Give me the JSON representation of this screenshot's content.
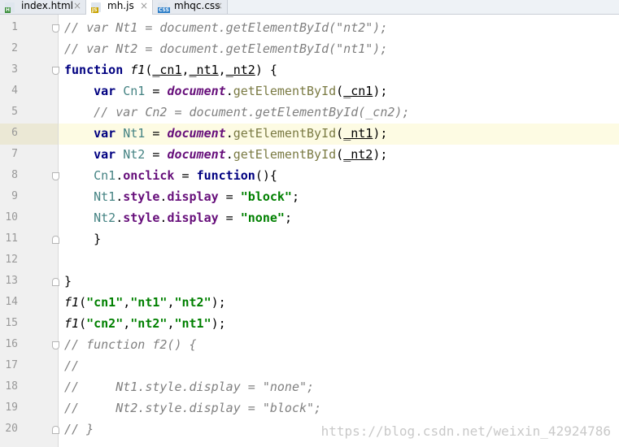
{
  "tabs": [
    {
      "label": "index.html",
      "icon": "html-file-icon",
      "badge": "H",
      "badge_color": "#3b8f3b",
      "active": false
    },
    {
      "label": "mh.js",
      "icon": "js-file-icon",
      "badge": "JS",
      "badge_color": "#c9a300",
      "active": true
    },
    {
      "label": "mhqc.css",
      "icon": "css-file-icon",
      "badge": "CSS",
      "badge_color": "#2a7cc7",
      "active": false
    }
  ],
  "tab_close_glyph": "×",
  "editor": {
    "current_line": 6,
    "lines": [
      {
        "n": "1",
        "fold": "open",
        "tokens": [
          [
            "cm",
            "// var Nt1 = document.getElementById(\"nt2\");"
          ]
        ]
      },
      {
        "n": "2",
        "fold": "",
        "tokens": [
          [
            "cm",
            "// var Nt2 = document.getElementById(\"nt1\");"
          ]
        ]
      },
      {
        "n": "3",
        "fold": "open",
        "tokens": [
          [
            "kw",
            "function "
          ],
          [
            "fn",
            "f1"
          ],
          [
            "",
            "("
          ],
          [
            "param",
            "_cn1"
          ],
          [
            "",
            ","
          ],
          [
            "param",
            "_nt1"
          ],
          [
            "",
            ","
          ],
          [
            "param",
            "_nt2"
          ],
          [
            "",
            ") {"
          ]
        ]
      },
      {
        "n": "4",
        "fold": "",
        "tokens": [
          [
            "",
            "    "
          ],
          [
            "kw",
            "var "
          ],
          [
            "lv",
            "Cn1"
          ],
          [
            "",
            " = "
          ],
          [
            "glob",
            "document"
          ],
          [
            "",
            "."
          ],
          [
            "mcall",
            "getElementById"
          ],
          [
            "",
            "("
          ],
          [
            "param",
            "_cn1"
          ],
          [
            "",
            ");"
          ]
        ]
      },
      {
        "n": "5",
        "fold": "",
        "tokens": [
          [
            "",
            "    "
          ],
          [
            "cm",
            "// var Cn2 = document.getElementById(_cn2);"
          ]
        ]
      },
      {
        "n": "6",
        "fold": "",
        "tokens": [
          [
            "",
            "    "
          ],
          [
            "kw",
            "var "
          ],
          [
            "lv",
            "Nt1"
          ],
          [
            "",
            " = "
          ],
          [
            "glob",
            "document"
          ],
          [
            "",
            "."
          ],
          [
            "mcall",
            "getElementById"
          ],
          [
            "",
            "("
          ],
          [
            "param",
            "_nt1"
          ],
          [
            "",
            ");"
          ]
        ]
      },
      {
        "n": "7",
        "fold": "",
        "tokens": [
          [
            "",
            "    "
          ],
          [
            "kw",
            "var "
          ],
          [
            "lv",
            "Nt2"
          ],
          [
            "",
            " = "
          ],
          [
            "glob",
            "document"
          ],
          [
            "",
            "."
          ],
          [
            "mcall",
            "getElementById"
          ],
          [
            "",
            "("
          ],
          [
            "param",
            "_nt2"
          ],
          [
            "",
            ");"
          ]
        ]
      },
      {
        "n": "8",
        "fold": "open",
        "tokens": [
          [
            "",
            "    "
          ],
          [
            "lv",
            "Cn1"
          ],
          [
            "",
            "."
          ],
          [
            "prop",
            "onclick"
          ],
          [
            "",
            " = "
          ],
          [
            "kw",
            "function"
          ],
          [
            "",
            "(){"
          ]
        ]
      },
      {
        "n": "9",
        "fold": "",
        "tokens": [
          [
            "",
            "    "
          ],
          [
            "lv",
            "Nt1"
          ],
          [
            "",
            "."
          ],
          [
            "prop",
            "style"
          ],
          [
            "",
            "."
          ],
          [
            "prop",
            "display"
          ],
          [
            "",
            " = "
          ],
          [
            "str",
            "\"block\""
          ],
          [
            "",
            ";"
          ]
        ]
      },
      {
        "n": "10",
        "fold": "",
        "tokens": [
          [
            "",
            "    "
          ],
          [
            "lv",
            "Nt2"
          ],
          [
            "",
            "."
          ],
          [
            "prop",
            "style"
          ],
          [
            "",
            "."
          ],
          [
            "prop",
            "display"
          ],
          [
            "",
            " = "
          ],
          [
            "str",
            "\"none\""
          ],
          [
            "",
            ";"
          ]
        ]
      },
      {
        "n": "11",
        "fold": "close",
        "tokens": [
          [
            "",
            "    }"
          ]
        ]
      },
      {
        "n": "12",
        "fold": "",
        "tokens": [
          [
            "",
            ""
          ]
        ]
      },
      {
        "n": "13",
        "fold": "close",
        "tokens": [
          [
            "",
            "}"
          ]
        ]
      },
      {
        "n": "14",
        "fold": "",
        "tokens": [
          [
            "fn",
            "f1"
          ],
          [
            "",
            "("
          ],
          [
            "str",
            "\"cn1\""
          ],
          [
            "",
            ","
          ],
          [
            "str",
            "\"nt1\""
          ],
          [
            "",
            ","
          ],
          [
            "str",
            "\"nt2\""
          ],
          [
            "",
            ");"
          ]
        ]
      },
      {
        "n": "15",
        "fold": "",
        "tokens": [
          [
            "fn",
            "f1"
          ],
          [
            "",
            "("
          ],
          [
            "str",
            "\"cn2\""
          ],
          [
            "",
            ","
          ],
          [
            "str",
            "\"nt2\""
          ],
          [
            "",
            ","
          ],
          [
            "str",
            "\"nt1\""
          ],
          [
            "",
            ");"
          ]
        ]
      },
      {
        "n": "16",
        "fold": "open",
        "tokens": [
          [
            "cm",
            "// function f2() {"
          ]
        ]
      },
      {
        "n": "17",
        "fold": "",
        "tokens": [
          [
            "cm",
            "//"
          ]
        ]
      },
      {
        "n": "18",
        "fold": "",
        "tokens": [
          [
            "cm",
            "//     Nt1.style.display = \"none\";"
          ]
        ]
      },
      {
        "n": "19",
        "fold": "",
        "tokens": [
          [
            "cm",
            "//     Nt2.style.display = \"block\";"
          ]
        ]
      },
      {
        "n": "20",
        "fold": "close",
        "tokens": [
          [
            "cm",
            "// }"
          ]
        ]
      }
    ]
  },
  "watermark": "https://blog.csdn.net/weixin_42924786"
}
